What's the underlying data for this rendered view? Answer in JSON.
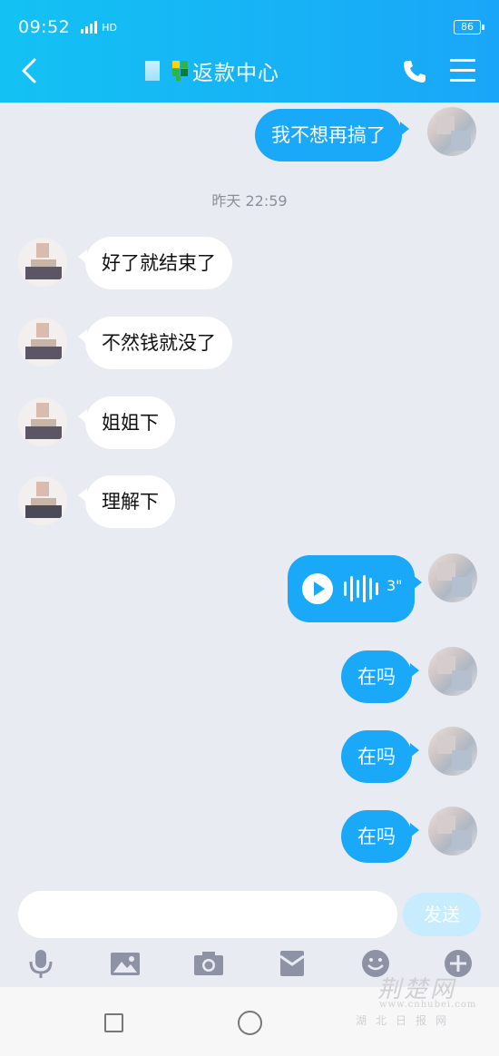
{
  "status_bar": {
    "time": "09:52",
    "network": "HD",
    "battery": "86"
  },
  "header": {
    "title": "返款中心",
    "back_icon": "back-arrow-icon",
    "call_icon": "phone-icon",
    "menu_icon": "menu-icon"
  },
  "messages": [
    {
      "side": "out",
      "type": "text",
      "text": "我不想再搞了"
    },
    {
      "type": "timestamp",
      "text": "昨天 22:59"
    },
    {
      "side": "in",
      "type": "text",
      "text": "好了就结束了"
    },
    {
      "side": "in",
      "type": "text",
      "text": "不然钱就没了"
    },
    {
      "side": "in",
      "type": "text",
      "text": "姐姐下"
    },
    {
      "side": "in",
      "type": "text",
      "text": "理解下"
    },
    {
      "side": "out",
      "type": "voice",
      "duration": "3\""
    },
    {
      "side": "out",
      "type": "text",
      "text": "在吗"
    },
    {
      "side": "out",
      "type": "text",
      "text": "在吗"
    },
    {
      "side": "out",
      "type": "text",
      "text": "在吗"
    }
  ],
  "composer": {
    "input_value": "",
    "send_label": "发送"
  },
  "toolbar_icons": [
    "microphone-icon",
    "image-icon",
    "camera-icon",
    "red-packet-icon",
    "emoji-icon",
    "plus-icon"
  ],
  "watermark": {
    "line1": "荆楚网",
    "line2": "www.cnhubei.com",
    "line3": "湖北日报网"
  },
  "colors": {
    "header_start": "#13c2f3",
    "header_end": "#1aa6f8",
    "bubble_out": "#1aa8f8",
    "bubble_in": "#ffffff",
    "background": "#e9ebf2"
  }
}
